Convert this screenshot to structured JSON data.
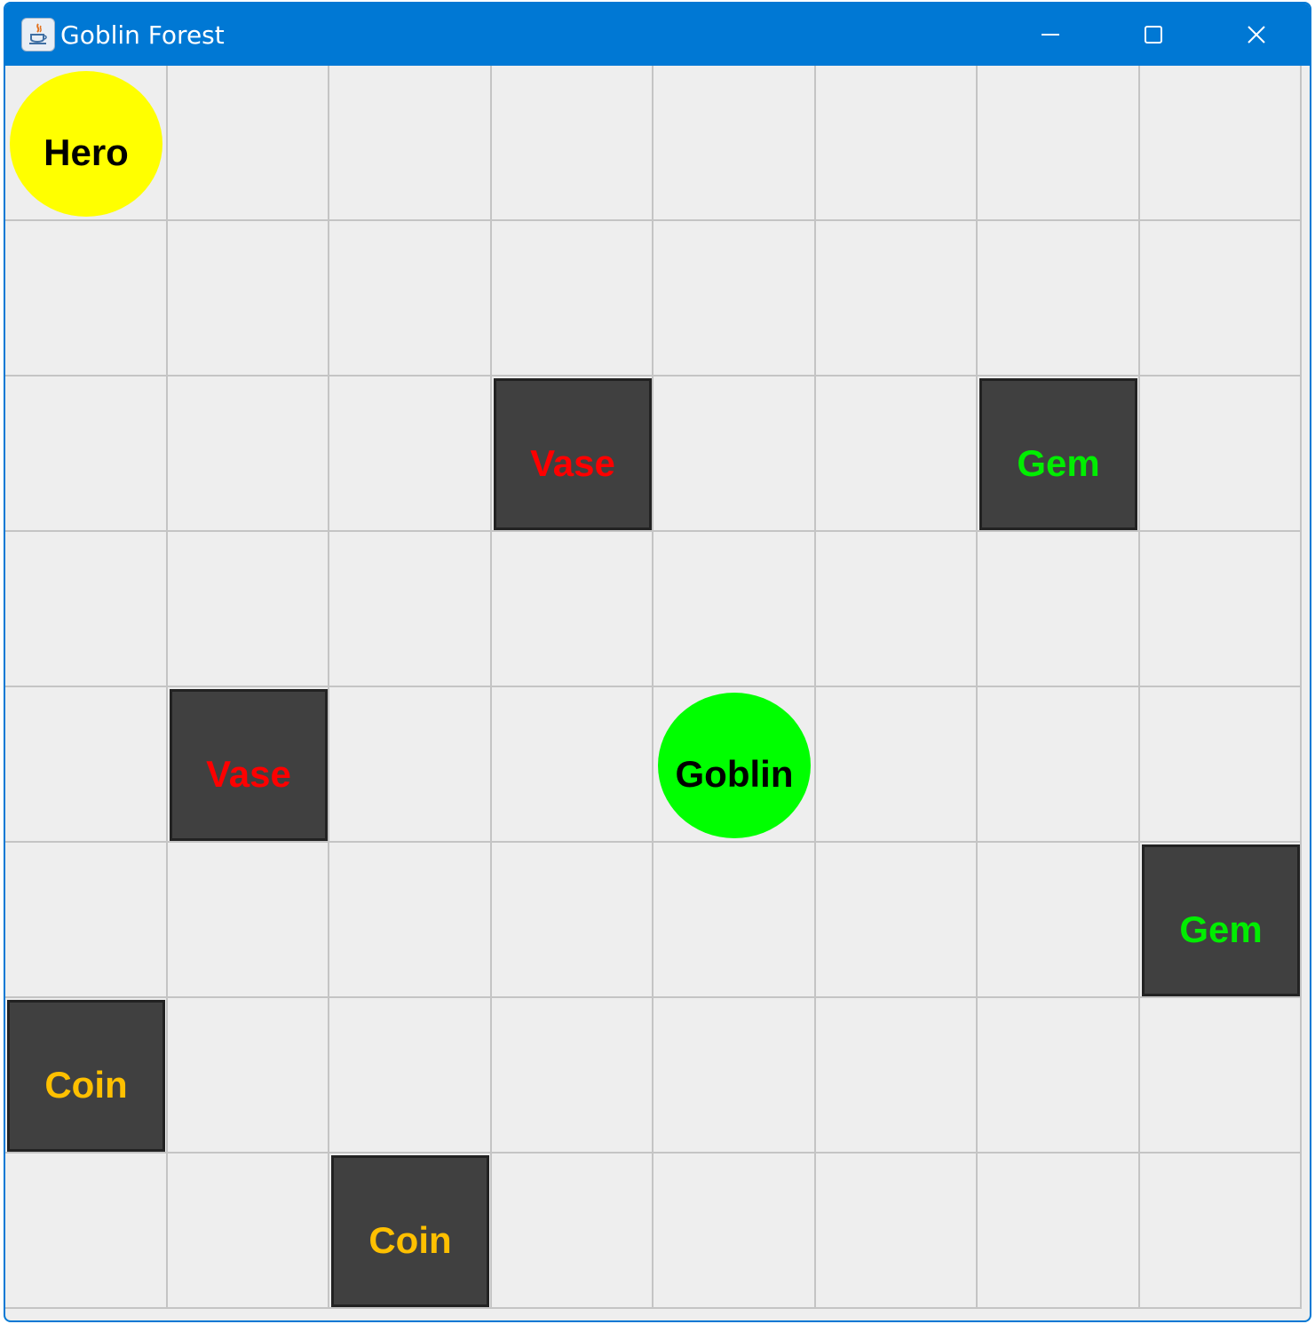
{
  "window": {
    "title": "Goblin Forest",
    "titlebar_color": "#0078d4",
    "app_icon": "java-coffee-cup-icon",
    "controls": {
      "minimize": "minimize-icon",
      "maximize": "maximize-icon",
      "close": "close-icon"
    }
  },
  "board": {
    "rows": 8,
    "cols": 8,
    "background": "#eeeeee",
    "grid_color": "#c4c4c4",
    "characters": [
      {
        "label": "Hero",
        "row": 0,
        "col": 0,
        "color": "#ffff00"
      },
      {
        "label": "Goblin",
        "row": 4,
        "col": 4,
        "color": "#00ff00"
      }
    ],
    "items": [
      {
        "label": "Vase",
        "row": 2,
        "col": 3,
        "text_color": "#ff0000"
      },
      {
        "label": "Gem",
        "row": 2,
        "col": 6,
        "text_color": "#00ee00"
      },
      {
        "label": "Vase",
        "row": 4,
        "col": 1,
        "text_color": "#ff0000"
      },
      {
        "label": "Gem",
        "row": 5,
        "col": 7,
        "text_color": "#00ee00"
      },
      {
        "label": "Coin",
        "row": 6,
        "col": 0,
        "text_color": "#ffc000"
      },
      {
        "label": "Coin",
        "row": 7,
        "col": 2,
        "text_color": "#ffc000"
      }
    ],
    "item_box_color": "#404040"
  }
}
